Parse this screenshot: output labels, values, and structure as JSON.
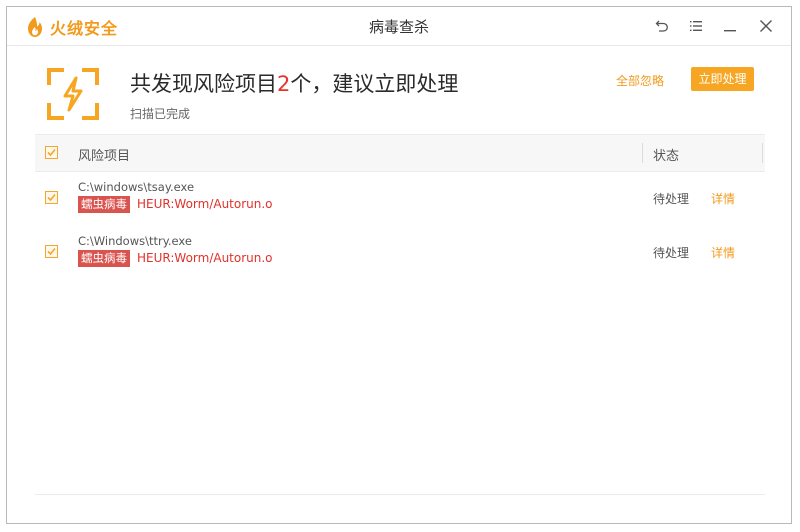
{
  "app": {
    "brand": "火绒安全",
    "window_title": "病毒查杀",
    "brand_color": "#f29a1c",
    "accent_color": "#f6a623",
    "danger_color": "#e9322b"
  },
  "titlebar_icons": [
    "back-icon",
    "menu-icon",
    "minimize-icon",
    "close-icon"
  ],
  "summary": {
    "headline_prefix": "共发现风险项目",
    "count": "2",
    "headline_suffix": "个，建议立即处理",
    "status_text": "扫描已完成",
    "icon": "lightning-alert-icon"
  },
  "actions": {
    "ignore_all": "全部忽略",
    "handle_now": "立即处理"
  },
  "table": {
    "header_checked": true,
    "col_name": "风险项目",
    "col_status": "状态",
    "rows": [
      {
        "checked": true,
        "path": "C:\\windows\\tsay.exe",
        "tag": "蠕虫病毒",
        "threat": "HEUR:Worm/Autorun.o",
        "status": "待处理",
        "detail": "详情"
      },
      {
        "checked": true,
        "path": "C:\\Windows\\ttry.exe",
        "tag": "蠕虫病毒",
        "threat": "HEUR:Worm/Autorun.o",
        "status": "待处理",
        "detail": "详情"
      }
    ]
  }
}
